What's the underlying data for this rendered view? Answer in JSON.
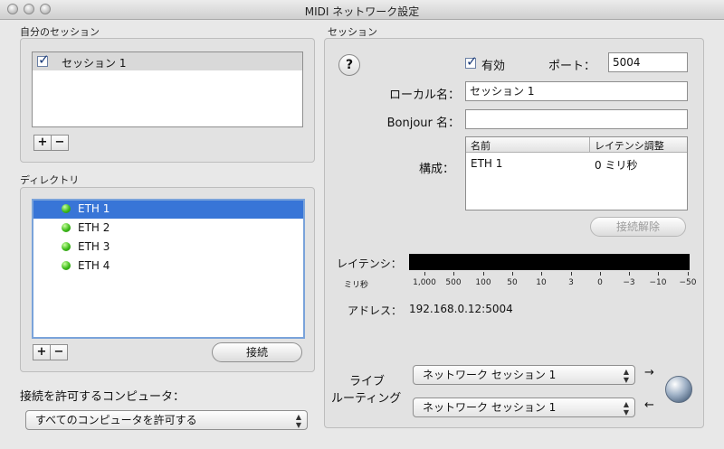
{
  "window": {
    "title": "MIDI ネットワーク設定"
  },
  "my_sessions": {
    "label": "自分のセッション",
    "items": [
      {
        "name": "セッション 1",
        "checked": true
      }
    ],
    "add_label": "+",
    "remove_label": "−"
  },
  "directory": {
    "label": "ディレクトリ",
    "items": [
      {
        "name": "ETH 1"
      },
      {
        "name": "ETH 2"
      },
      {
        "name": "ETH 3"
      },
      {
        "name": "ETH 4"
      }
    ],
    "selected_index": 0,
    "status_color": "#3ebc1a",
    "add_label": "+",
    "remove_label": "−",
    "connect_label": "接続"
  },
  "allow": {
    "label": "接続を許可するコンピュータ：",
    "value": "すべてのコンピュータを許可する"
  },
  "session": {
    "label": "セッション",
    "help_label": "?",
    "enabled_label": "有効",
    "enabled": true,
    "port_label": "ポート：",
    "port_value": "5004",
    "local_name_label": "ローカル名：",
    "local_name_value": "セッション 1",
    "bonjour_label": "Bonjour 名：",
    "bonjour_value": "",
    "participants_label": "構成：",
    "columns": [
      "名前",
      "レイテンシ調整"
    ],
    "rows": [
      {
        "name": "ETH 1",
        "latency": "0 ミリ秒"
      }
    ],
    "disconnect_label": "接続解除",
    "latency_label": "レイテンシ：",
    "latency_unit": "ミリ秒",
    "latency_ticks": [
      "1,000",
      "500",
      "100",
      "50",
      "10",
      "3",
      "0",
      "−3",
      "−10",
      "−50"
    ],
    "address_label": "アドレス：",
    "address_value": "192.168.0.12:5004",
    "live_routing_label_1": "ライブ",
    "live_routing_label_2": "ルーティング",
    "routing_in": "ネットワーク セッション 1",
    "routing_out": "ネットワーク セッション 1",
    "arrow_right": "→",
    "arrow_left": "←"
  },
  "colors": {
    "selection": "#3875d7",
    "accent": "#1c3d7a"
  }
}
